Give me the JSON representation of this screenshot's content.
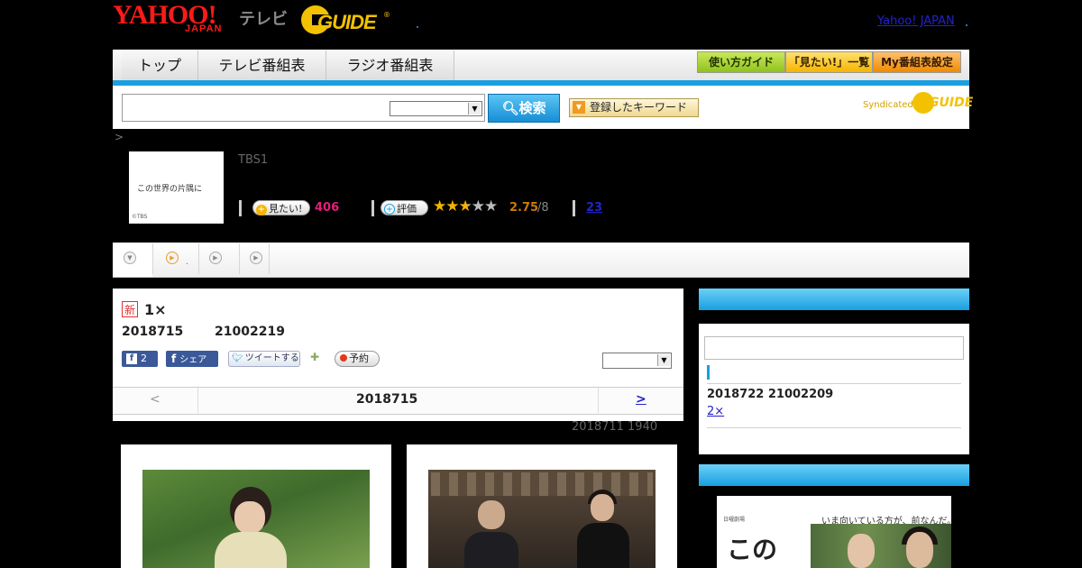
{
  "header": {
    "logo_yahoo": "YAHOO!",
    "logo_japan": "JAPAN",
    "logo_tv": "テレビ",
    "logo_gguide": "GUIDE",
    "logo_reg": "®",
    "yahoo_japan_link": "Yahoo! JAPAN"
  },
  "nav": {
    "tabs": [
      "トップ",
      "テレビ番組表",
      "ラジオ番組表"
    ],
    "buttons": {
      "guide": "使い方ガイド",
      "mitai_list": "「見たい!」一覧",
      "my_schedule": "My番組表設定"
    }
  },
  "search": {
    "input_value": "",
    "select_value": "",
    "button_label": "検索",
    "keyword_button": "登録したキーワード",
    "syndicated": "Syndicated",
    "syndicated_brand": "GUIDE"
  },
  "breadcrumb": {
    "arrow": ">"
  },
  "program": {
    "thumb_title": "この世界の片隅に",
    "thumb_caption": "©TBS",
    "channel": "TBS1",
    "mitai_label": "見たい!",
    "mitai_count": "406",
    "rating_label": "評価",
    "rating_value": 2.75,
    "rating_stars": 5,
    "score": "2.75",
    "score_max": "/8",
    "review_count": "23"
  },
  "tabbar": {
    "dot_text": "."
  },
  "episode": {
    "new_badge": "新",
    "title": "1×",
    "date": "2018715",
    "time": "21002219",
    "fb_like_count": "2",
    "fb_share": "シェア",
    "tweet": "ツイートする",
    "reserve": "予約",
    "select_value": ""
  },
  "pager": {
    "prev": "<",
    "current_date": "2018715",
    "next": ">"
  },
  "original_air": "2018711  1940",
  "sidebar": {
    "next_date": "2018722",
    "next_time": "21002209",
    "next_episode_link": "2×"
  },
  "poster": {
    "catch_copy": "いま向いている方が、前なんだ。",
    "small_label": "日曜劇場",
    "title_big": "この"
  },
  "colors": {
    "accent_blue": "#1a9fe0",
    "yahoo_red": "#ff1a1a",
    "gguide_yellow": "#f2c200",
    "mitai_pink": "#e0207a",
    "score_orange": "#cc7a00",
    "link_blue": "#2222cc"
  }
}
